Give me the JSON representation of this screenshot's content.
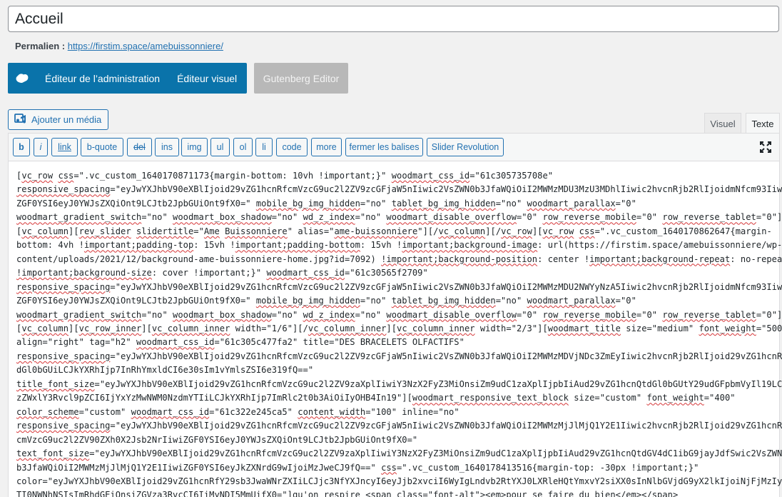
{
  "post": {
    "title": "Accueil",
    "permalink_label": "Permalien :",
    "permalink_url": "https://firstim.space/amebuissonniere/"
  },
  "builder": {
    "admin_editor": "Éditeur de l’administration",
    "visual_editor": "Éditeur visuel",
    "gutenberg": "Gutenberg Editor"
  },
  "media": {
    "add_media": "Ajouter un média"
  },
  "tabs": {
    "visual": "Visuel",
    "text": "Texte"
  },
  "quicktags": [
    "b",
    "i",
    "link",
    "b-quote",
    "del",
    "ins",
    "img",
    "ul",
    "ol",
    "li",
    "code",
    "more",
    "fermer les balises",
    "Slider Revolution"
  ],
  "content_lines": [
    [
      [
        "[",
        0
      ],
      [
        "vc_row",
        1
      ],
      [
        " ",
        0
      ],
      [
        "css",
        1
      ],
      [
        "=\".vc_custom_1640170871173{margin-bottom: 10vh !important;}\" ",
        0
      ],
      [
        "woodmart_css_id",
        1
      ],
      [
        "=\"61c305735708e\"",
        0
      ]
    ],
    [
      [
        "responsive_spacing",
        1
      ],
      [
        "=\"eyJwYXJhbV90eXBlIjoid29vZG1hcnRfcmVzcG9uc2l2ZV9zcGFjaW5nIiwic2VsZWN0b3JfaWQiOiI2MWMzMDU3MzU3MDhlIiwic2hvcnRjb2RlIjoidmNfcm93Iiwi",
        0
      ]
    ],
    [
      [
        "ZGF0YSI6eyJ0YWJsZXQiOnt9LCJtb2JpbGUiOnt9fX0=\" ",
        0
      ],
      [
        "mobile_bg_img_hidden",
        1
      ],
      [
        "=\"no\" ",
        0
      ],
      [
        "tablet_bg_img_hidden",
        1
      ],
      [
        "=\"no\" ",
        0
      ],
      [
        "woodmart_parallax",
        1
      ],
      [
        "=\"0\"",
        0
      ]
    ],
    [
      [
        "woodmart_gradient_switch",
        1
      ],
      [
        "=\"no\" ",
        0
      ],
      [
        "woodmart_box_shadow",
        1
      ],
      [
        "=\"no\" ",
        0
      ],
      [
        "wd_z_index",
        1
      ],
      [
        "=\"no\" ",
        0
      ],
      [
        "woodmart_disable_overflow",
        1
      ],
      [
        "=\"0\" ",
        0
      ],
      [
        "row_reverse_mobile",
        1
      ],
      [
        "=\"0\" ",
        0
      ],
      [
        "row_reverse_tablet",
        1
      ],
      [
        "=\"0\"]",
        0
      ]
    ],
    [
      [
        "[",
        0
      ],
      [
        "vc_column",
        1
      ],
      [
        "][",
        0
      ],
      [
        "rev_slider",
        1
      ],
      [
        " ",
        0
      ],
      [
        "slidertitle",
        1
      ],
      [
        "=\"",
        0
      ],
      [
        "Ame",
        1
      ],
      [
        " ",
        0
      ],
      [
        "Buissonniere",
        1
      ],
      [
        "\" alias=\"",
        0
      ],
      [
        "ame-buissonniere",
        1
      ],
      [
        "\"][/",
        0
      ],
      [
        "vc_column",
        1
      ],
      [
        "][/",
        0
      ],
      [
        "vc_row",
        1
      ],
      [
        "][",
        0
      ],
      [
        "vc_row",
        1
      ],
      [
        " ",
        0
      ],
      [
        "css",
        1
      ],
      [
        "=\".vc_custom_1640170862647{margin-",
        0
      ]
    ],
    [
      [
        "bottom: 4vh !",
        0
      ],
      [
        "important;padding-top",
        1
      ],
      [
        ": 15vh !",
        0
      ],
      [
        "important;padding-bottom",
        1
      ],
      [
        ": 15vh !",
        0
      ],
      [
        "important;background-image",
        1
      ],
      [
        ": url(https://firstim.space/amebuissonniere/wp-",
        0
      ]
    ],
    [
      [
        "content/uploads/2021/12/background-ame-buissonniere-home.jpg?id=7092) ",
        0
      ],
      [
        "!important;background-position",
        1
      ],
      [
        ": center !",
        0
      ],
      [
        "important;background-repeat",
        1
      ],
      [
        ": no-repeat",
        0
      ]
    ],
    [
      [
        "!important;background-size",
        1
      ],
      [
        ": cover !important;}\" ",
        0
      ],
      [
        "woodmart_css_id",
        1
      ],
      [
        "=\"61c30565f2709\"",
        0
      ]
    ],
    [
      [
        "responsive_spacing",
        1
      ],
      [
        "=\"eyJwYXJhbV90eXBlIjoid29vZG1hcnRfcmVzcG9uc2l2ZV9zcGFjaW5nIiwic2VsZWN0b3JfaWQiOiI2MWMzMDU2NWYyNzA5Iiwic2hvcnRjb2RlIjoidmNfcm93Iiwi",
        0
      ]
    ],
    [
      [
        "ZGF0YSI6eyJ0YWJsZXQiOnt9LCJtb2JpbGUiOnt9fX0=\" ",
        0
      ],
      [
        "mobile_bg_img_hidden",
        1
      ],
      [
        "=\"no\" ",
        0
      ],
      [
        "tablet_bg_img_hidden",
        1
      ],
      [
        "=\"no\" ",
        0
      ],
      [
        "woodmart_parallax",
        1
      ],
      [
        "=\"0\"",
        0
      ]
    ],
    [
      [
        "woodmart_gradient_switch",
        1
      ],
      [
        "=\"no\" ",
        0
      ],
      [
        "woodmart_box_shadow",
        1
      ],
      [
        "=\"no\" ",
        0
      ],
      [
        "wd_z_index",
        1
      ],
      [
        "=\"no\" ",
        0
      ],
      [
        "woodmart_disable_overflow",
        1
      ],
      [
        "=\"0\" ",
        0
      ],
      [
        "row_reverse_mobile",
        1
      ],
      [
        "=\"0\" ",
        0
      ],
      [
        "row_reverse_tablet",
        1
      ],
      [
        "=\"0\"]",
        0
      ]
    ],
    [
      [
        "[",
        0
      ],
      [
        "vc_column",
        1
      ],
      [
        "][",
        0
      ],
      [
        "vc_row_inner",
        1
      ],
      [
        "][",
        0
      ],
      [
        "vc_column_inner",
        1
      ],
      [
        " width=\"1/6\"][/",
        0
      ],
      [
        "vc_column_inner",
        1
      ],
      [
        "][",
        0
      ],
      [
        "vc_column_inner",
        1
      ],
      [
        " width=\"2/3\"][",
        0
      ],
      [
        "woodmart_title",
        1
      ],
      [
        " size=\"medium\" ",
        0
      ],
      [
        "font_weight",
        1
      ],
      [
        "=\"500\"",
        0
      ]
    ],
    [
      [
        "align=\"right\" tag=\"h2\" ",
        0
      ],
      [
        "woodmart_css_id",
        1
      ],
      [
        "=\"61c305c477fa2\" title=\"DES BRACELETS OLFACTIFS\"",
        0
      ]
    ],
    [
      [
        "responsive_spacing",
        1
      ],
      [
        "=\"eyJwYXJhbV90eXBlIjoid29vZG1hcnRfcmVzcG9uc2l2ZV9zcGFjaW5nIiwic2VsZWN0b3JfaWQiOiI2MWMzMDVjNDc3ZmEyIiwic2hvcnRjb2RlIjoid29vZG1hcnRf",
        0
      ]
    ],
    [
      [
        "dGl0bGUiLCJkYXRhIjp7InRhYmxldCI6e30sIm1vYmlsZSI6e319fQ==\"",
        0
      ]
    ],
    [
      [
        "title_font_size",
        1
      ],
      [
        "=\"eyJwYXJhbV90eXBlIjoid29vZG1hcnRfcmVzcG9uc2l2ZV9zaXplIiwiY3NzX2FyZ3MiOnsiZm9udC1zaXplIjpbIiAud29vZG1hcnQtdGl0bGUtY29udGFpbmVyIl19LCJ",
        0
      ]
    ],
    [
      [
        "zZWxlY3Rvcl9pZCI6IjYxYzMwNWM0NzdmYTIiLCJkYXRhIjp7ImRlc2t0b3AiOiIyOHB4In19\"][",
        0
      ],
      [
        "woodmart_responsive_text_block",
        1
      ],
      [
        " size=\"custom\" ",
        0
      ],
      [
        "font_weight",
        1
      ],
      [
        "=\"400\"",
        0
      ]
    ],
    [
      [
        "color_scheme",
        1
      ],
      [
        "=\"custom\" ",
        0
      ],
      [
        "woodmart_css_id",
        1
      ],
      [
        "=\"61c322e245ca5\" ",
        0
      ],
      [
        "content_width",
        1
      ],
      [
        "=\"100\" inline=\"no\"",
        0
      ]
    ],
    [
      [
        "responsive_spacing",
        1
      ],
      [
        "=\"eyJwYXJhbV90eXBlIjoid29vZG1hcnRfcmVzcG9uc2l2ZV9zcGFjaW5nIiwic2VsZWN0b3JfaWQiOiI2MWMzMjJlMjQ1Y2E1Iiwic2hvcnRjb2RlIjoid29vZG1hcnRf",
        0
      ]
    ],
    [
      [
        "cmVzcG9uc2l2ZV90ZXh0X2Jsb2NrIiwiZGF0YSI6eyJ0YWJsZXQiOnt9LCJtb2JpbGUiOnt9fX0=\"",
        0
      ]
    ],
    [
      [
        "text_font_size",
        1
      ],
      [
        "=\"eyJwYXJhbV90eXBlIjoid29vZG1hcnRfcmVzcG9uc2l2ZV9zaXplIiwiY3NzX2FyZ3MiOnsiZm9udC1zaXplIjpbIiAud29vZG1hcnQtdGV4dC1ibG9jayJdfSwic2VsZWN0",
        0
      ]
    ],
    [
      [
        "b3JfaWQiOiI2MWMzMjJlMjQ1Y2E1IiwiZGF0YSI6eyJkZXNrdG9wIjoiMzJweCJ9fQ==\" ",
        0
      ],
      [
        "css",
        1
      ],
      [
        "=\".vc_custom_1640178413516{margin-top: -30px !important;}\"",
        0
      ]
    ],
    [
      [
        "color=\"eyJwYXJhbV90eXBlIjoid29vZG1hcnRfY29sb3JwaWNrZXIiLCJjc3NfYXJncyI6eyJjb2xvciI6WyIgLndvb2RtYXJ0LXRleHQtYmxvY2siXX0sInNlbGVjdG9yX2lkIjoiNjFjMzIyZ",
        0
      ]
    ],
    [
      [
        "TI0NWNhNSIsImRhdGEiOnsiZGVza3RvcCI6IiMyNDI5MmUifX0=\"]",
        0
      ],
      [
        "qu'on",
        1
      ],
      [
        " respire <span class=\"font-alt\"><em>pour se faire du bien</em></span>",
        0
      ]
    ]
  ]
}
